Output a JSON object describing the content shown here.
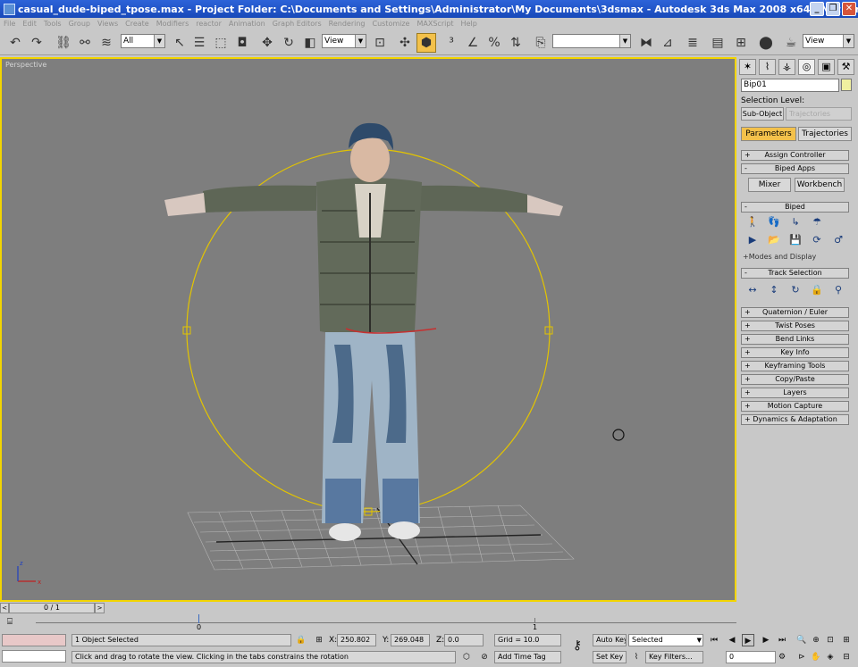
{
  "titlebar": {
    "title": "casual_dude-biped_tpose.max    - Project Folder: C:\\Documents and Settings\\Administrator\\My Documents\\3dsmax    - Autodesk 3ds Max 2008 x64    - Not for Resale    - Display : Direct 3D"
  },
  "menu": [
    "File",
    "Edit",
    "Tools",
    "Group",
    "Views",
    "Create",
    "Modifiers",
    "reactor",
    "Animation",
    "Graph Editors",
    "Rendering",
    "Customize",
    "MAXScript",
    "Help"
  ],
  "toolbar": {
    "selection_filter": "All",
    "ref_coord": "View",
    "named_selection": "",
    "viewport_view": "View"
  },
  "viewport": {
    "label": "Perspective",
    "axis_x": "x",
    "axis_z": "z"
  },
  "command_panel": {
    "object_name": "Bip01",
    "selection_level_label": "Selection Level:",
    "sub_object_label": "Sub-Object",
    "sub_object_value": "Trajectories",
    "tabs": [
      "Parameters",
      "Trajectories"
    ],
    "rollouts_top": [
      {
        "sign": "+",
        "label": "Assign Controller"
      },
      {
        "sign": "-",
        "label": "Biped Apps"
      }
    ],
    "biped_apps_buttons": [
      "Mixer",
      "Workbench"
    ],
    "biped_rollout": {
      "sign": "-",
      "label": "Biped"
    },
    "modes_label": "+Modes and Display",
    "track_selection": {
      "sign": "-",
      "label": "Track Selection"
    },
    "rollouts_bottom": [
      {
        "sign": "+",
        "label": "Quaternion / Euler"
      },
      {
        "sign": "+",
        "label": "Twist Poses"
      },
      {
        "sign": "+",
        "label": "Bend Links"
      },
      {
        "sign": "+",
        "label": "Key Info"
      },
      {
        "sign": "+",
        "label": "Keyframing Tools"
      },
      {
        "sign": "+",
        "label": "Copy/Paste"
      },
      {
        "sign": "+",
        "label": "Layers"
      },
      {
        "sign": "+",
        "label": "Motion Capture"
      },
      {
        "sign": "+",
        "label": "Dynamics & Adaptation"
      }
    ]
  },
  "timeline": {
    "frame_display": "0 / 1",
    "prev": "<",
    "next": ">",
    "tick_start": "0",
    "tick_end": "1"
  },
  "status": {
    "objects_selected": "1 Object Selected",
    "prompt": "Click and drag to rotate the view.  Clicking in the tabs constrains the rotation",
    "x_label": "X:",
    "x_value": "250.802",
    "y_label": "Y:",
    "y_value": "269.048",
    "z_label": "Z:",
    "z_value": "0.0",
    "grid": "Grid = 10.0",
    "add_time_tag": "Add Time Tag",
    "auto_key": "Auto Key",
    "set_key": "Set Key",
    "key_mode": "Selected",
    "key_filters": "Key Filters...",
    "current_frame": "0"
  },
  "colors": {
    "viewport_bg": "#7e7e7e",
    "active_border": "#f2d400",
    "highlight": "#f3c14b",
    "titlebar": "#2d63d9"
  }
}
